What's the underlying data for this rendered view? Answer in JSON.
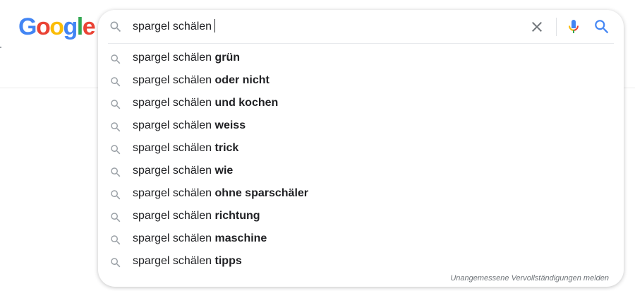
{
  "logo": {
    "letters": [
      "G",
      "o",
      "o",
      "g",
      "l",
      "e"
    ],
    "colors": [
      "#4285F4",
      "#EA4335",
      "#FBBC05",
      "#4285F4",
      "#34A853",
      "#EA4335"
    ]
  },
  "search": {
    "query": "spargel schälen",
    "icon": "search-icon",
    "clear_icon": "close-icon",
    "mic_icon": "microphone-icon",
    "submit_icon": "search-icon"
  },
  "suggestions": [
    {
      "prefix": "spargel schälen ",
      "completion": "grün"
    },
    {
      "prefix": "spargel schälen ",
      "completion": "oder nicht"
    },
    {
      "prefix": "spargel schälen ",
      "completion": "und kochen"
    },
    {
      "prefix": "spargel schälen ",
      "completion": "weiss"
    },
    {
      "prefix": "spargel schälen ",
      "completion": "trick"
    },
    {
      "prefix": "spargel schälen ",
      "completion": "wie"
    },
    {
      "prefix": "spargel schälen ",
      "completion": "ohne sparschäler"
    },
    {
      "prefix": "spargel schälen ",
      "completion": "richtung"
    },
    {
      "prefix": "spargel schälen ",
      "completion": "maschine"
    },
    {
      "prefix": "spargel schälen ",
      "completion": "tipps"
    }
  ],
  "footer": {
    "report_label": "Unangemessene Vervollständigungen melden"
  },
  "colors": {
    "icon_gray": "#9aa0a6",
    "submit_blue": "#4285F4",
    "clear_gray": "#70757a"
  }
}
